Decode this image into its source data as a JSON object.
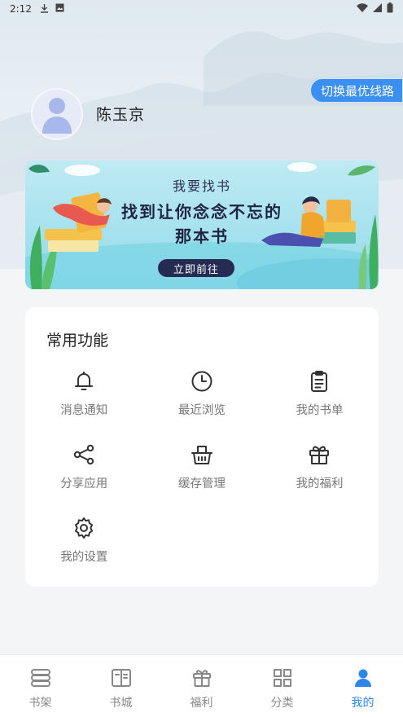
{
  "status_bar": {
    "time": "2:12",
    "icons": [
      "download-icon",
      "image-icon"
    ],
    "right_icons": [
      "wifi-icon",
      "signal-icon",
      "battery-icon"
    ]
  },
  "route_button": {
    "label": "切换最优线路"
  },
  "profile": {
    "username": "陈玉京"
  },
  "banner": {
    "subtitle": "我要找书",
    "title": "找到让你念念不忘的那本书",
    "button_label": "立即前往"
  },
  "functions": {
    "title": "常用功能",
    "items": [
      {
        "label": "消息通知",
        "icon": "bell-icon"
      },
      {
        "label": "最近浏览",
        "icon": "clock-icon"
      },
      {
        "label": "我的书单",
        "icon": "clipboard-icon"
      },
      {
        "label": "分享应用",
        "icon": "share-icon"
      },
      {
        "label": "缓存管理",
        "icon": "basket-icon"
      },
      {
        "label": "我的福利",
        "icon": "gift-icon"
      },
      {
        "label": "我的设置",
        "icon": "gear-icon"
      }
    ]
  },
  "bottom_nav": {
    "items": [
      {
        "label": "书架",
        "icon": "bookshelf-icon",
        "active": false
      },
      {
        "label": "书城",
        "icon": "open-book-icon",
        "active": false
      },
      {
        "label": "福利",
        "icon": "gift-icon",
        "active": false
      },
      {
        "label": "分类",
        "icon": "grid-icon",
        "active": false
      },
      {
        "label": "我的",
        "icon": "user-icon",
        "active": true
      }
    ]
  },
  "colors": {
    "accent": "#2f86ea",
    "route_button": "#3b8ff0",
    "banner_button": "#262b54",
    "inactive": "#888888"
  }
}
